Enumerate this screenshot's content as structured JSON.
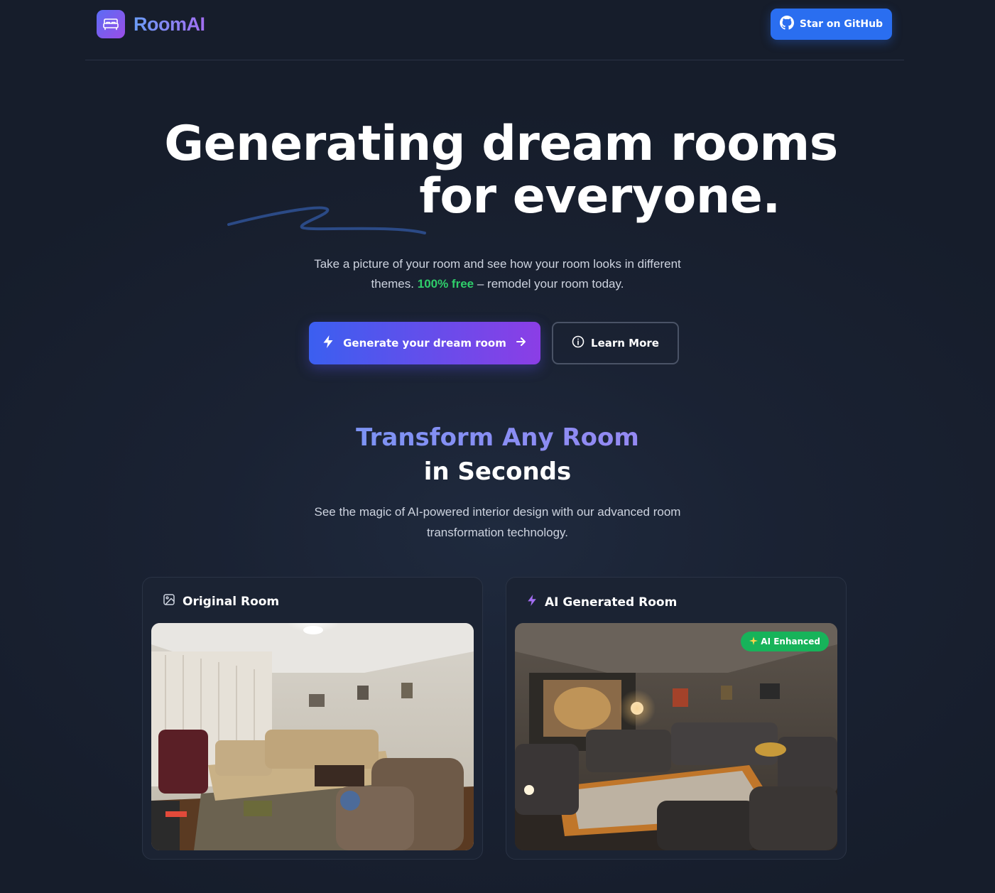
{
  "header": {
    "brand": "RoomAI",
    "github_button": "Star on GitHub"
  },
  "hero": {
    "title_line1": "Generating dream rooms",
    "title_line2": "for everyone.",
    "subtitle_before": "Take a picture of your room and see how your room looks in different",
    "subtitle_line2_start": "themes.",
    "subtitle_highlight": "100% free",
    "subtitle_end": "– remodel your room today.",
    "cta_label": "Generate your dream room",
    "learn_more_label": "Learn More"
  },
  "section": {
    "title_gradient": "Transform Any Room",
    "title_plain": "in Seconds",
    "desc_line1": "See the magic of AI-powered interior design with our advanced room",
    "desc_line2": "transformation technology."
  },
  "cards": {
    "original": {
      "label": "Original Room"
    },
    "generated": {
      "label": "AI Generated Room",
      "badge": "AI Enhanced"
    }
  },
  "colors": {
    "background": "#1a2233",
    "accent_blue": "#2a6ef0",
    "accent_purple": "#8b3ee6",
    "free_green": "#2fce6a",
    "badge_green": "#17b35a"
  },
  "icons": [
    "bed-icon",
    "github-icon",
    "bolt-icon",
    "arrow-right-icon",
    "info-icon",
    "image-icon",
    "sparkle-icon"
  ]
}
